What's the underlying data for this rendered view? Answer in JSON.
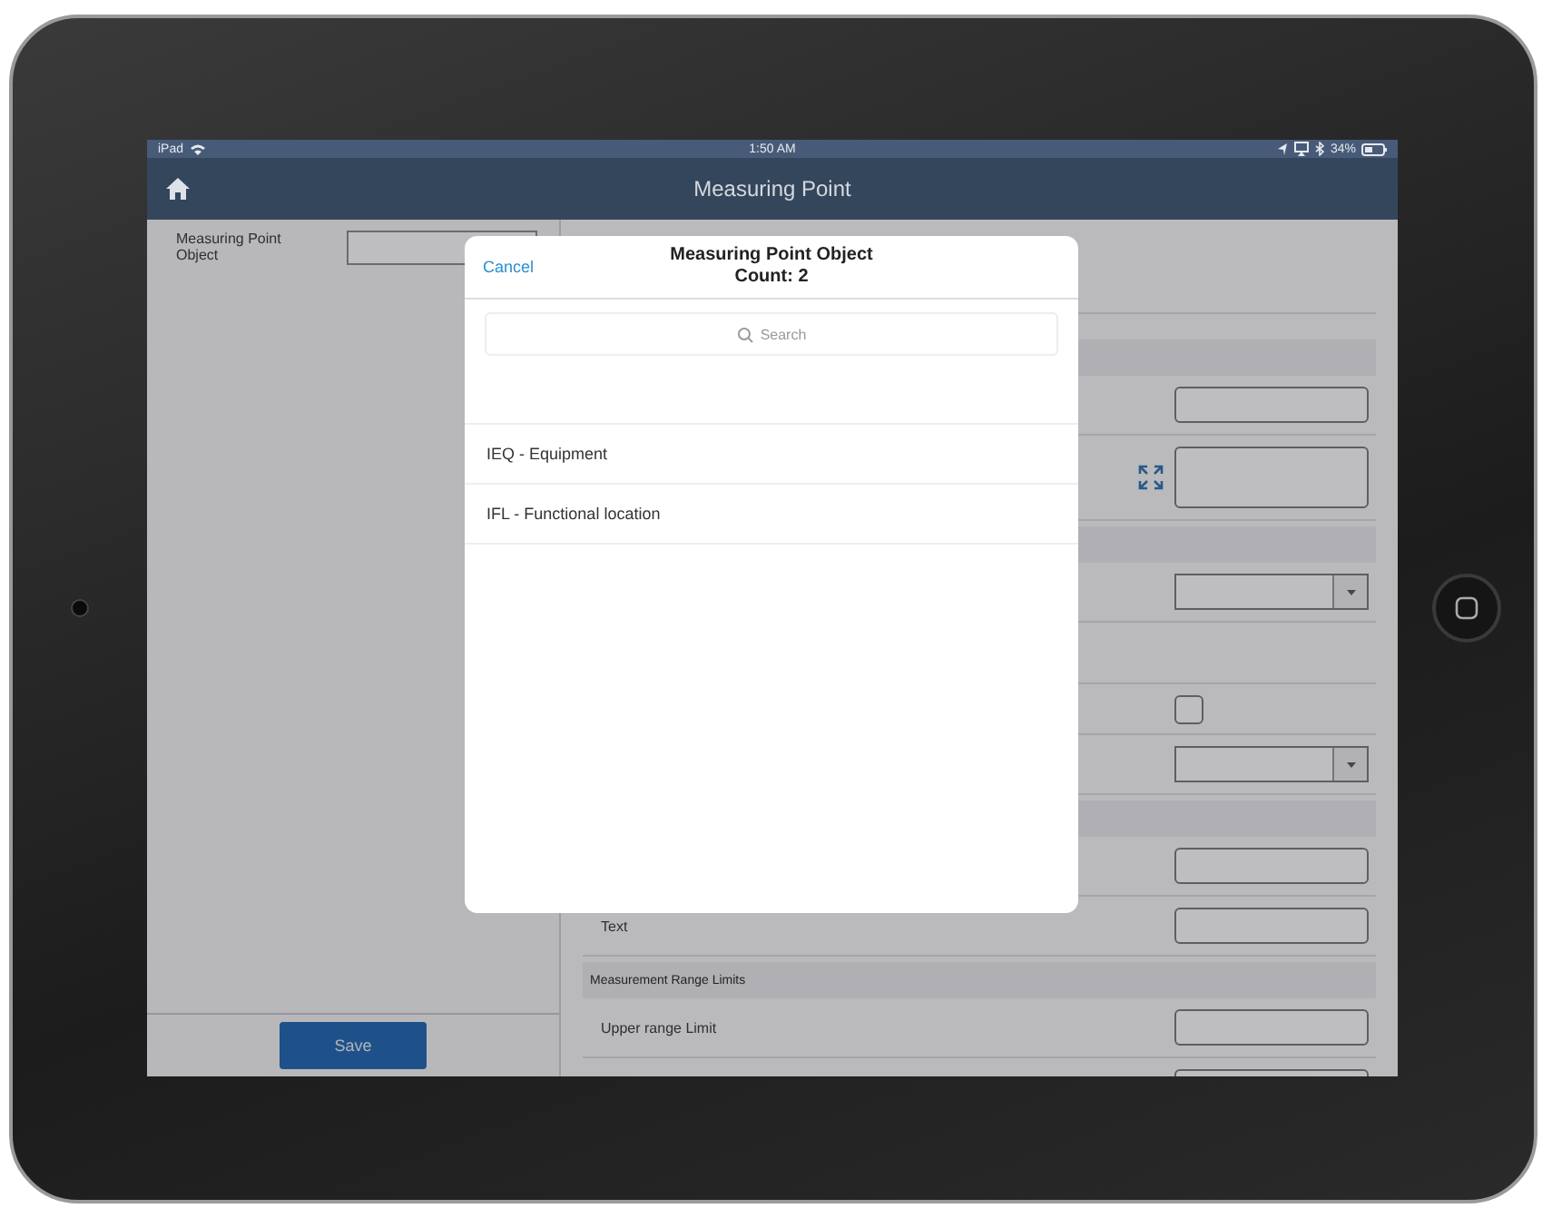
{
  "status_bar": {
    "carrier": "iPad",
    "time": "1:50 AM",
    "battery": "34%"
  },
  "nav_bar": {
    "title": "Measuring Point"
  },
  "left_pane": {
    "field_label": "Measuring Point Object",
    "save_button": "Save"
  },
  "form_rows": [
    {
      "kind": "blank"
    },
    {
      "kind": "section"
    },
    {
      "kind": "text"
    },
    {
      "kind": "textarea"
    },
    {
      "kind": "section"
    },
    {
      "kind": "dropdown"
    },
    {
      "kind": "blank"
    },
    {
      "kind": "checkbox",
      "checked": false
    },
    {
      "kind": "dropdown"
    },
    {
      "kind": "section"
    },
    {
      "kind": "text"
    },
    {
      "kind": "text",
      "label": "Text"
    },
    {
      "kind": "section",
      "label": "Measurement Range Limits"
    },
    {
      "kind": "text",
      "label": "Upper range Limit"
    },
    {
      "kind": "text"
    }
  ],
  "modal": {
    "cancel": "Cancel",
    "title": "Measuring Point Object",
    "count": "Count: 2",
    "search_placeholder": "Search",
    "items": [
      {
        "label": "IEQ - Equipment"
      },
      {
        "label": "IFL - Functional location"
      }
    ]
  }
}
